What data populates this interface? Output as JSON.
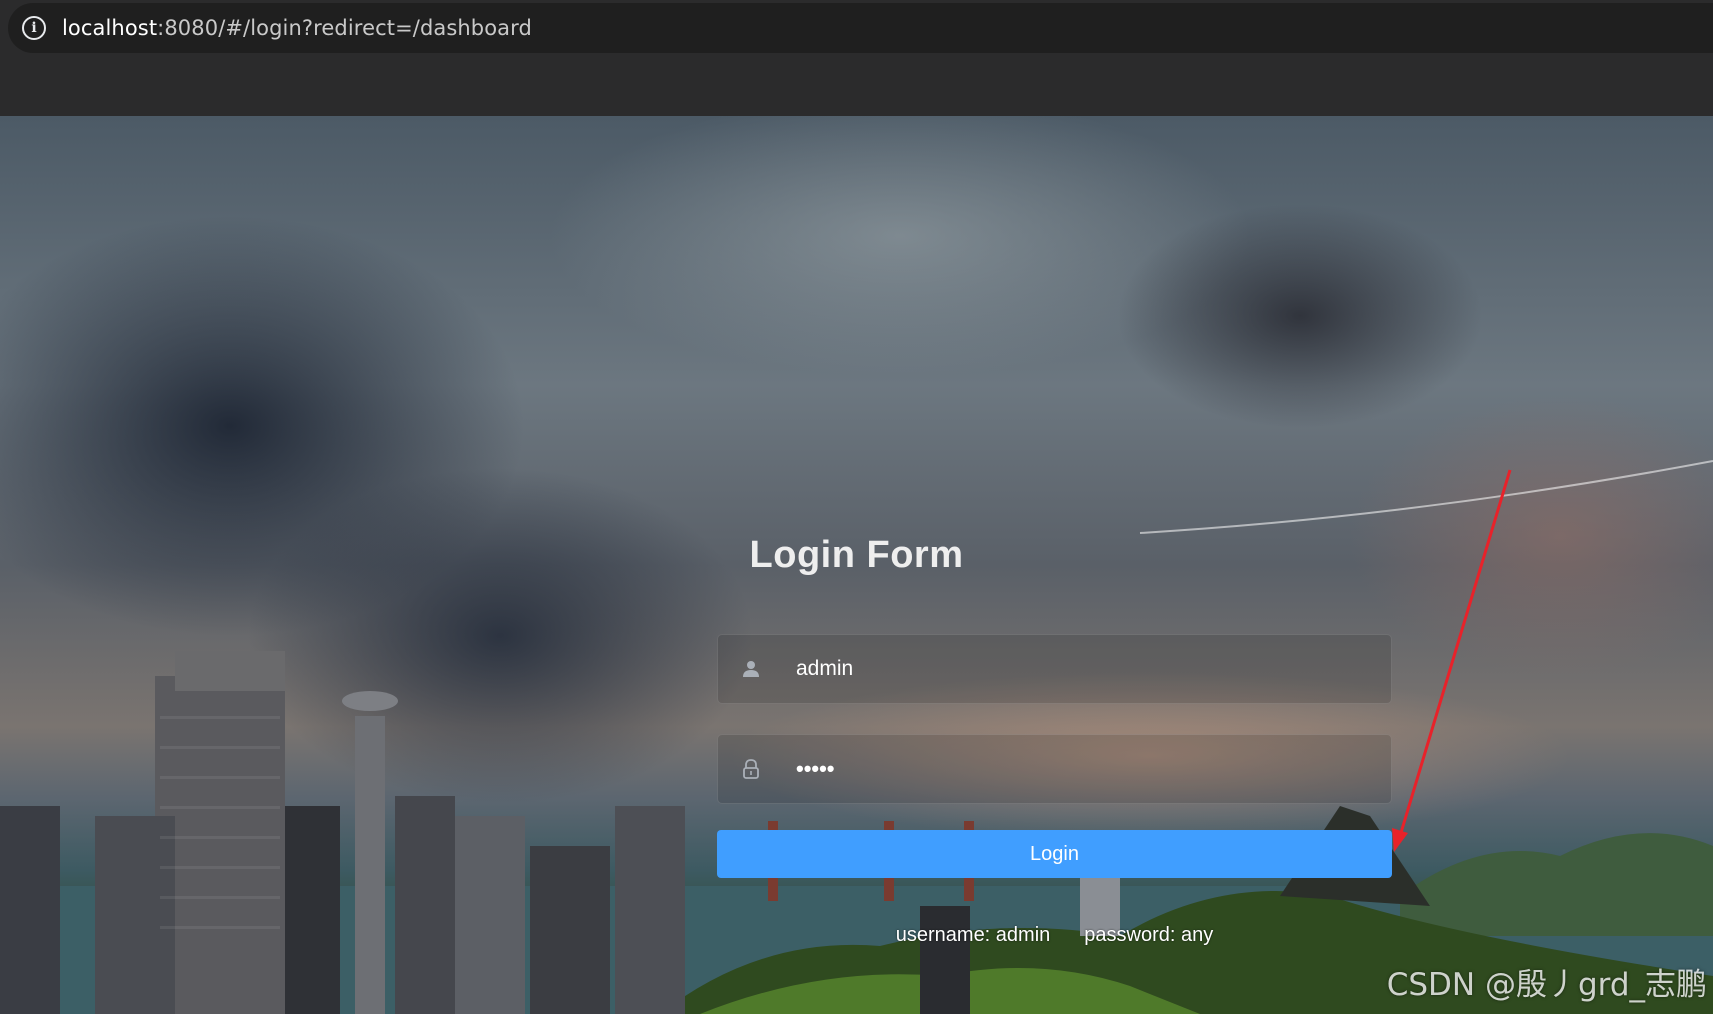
{
  "browser": {
    "url_host": "localhost",
    "url_rest": ":8080/#/login?redirect=/dashboard"
  },
  "login": {
    "title": "Login Form",
    "username_value": "admin",
    "password_mask": "•••••",
    "button_label": "Login",
    "tip_username": "username: admin",
    "tip_password": "password: any"
  },
  "watermark": "CSDN @殷丿grd_志鹏",
  "colors": {
    "button": "#409eff",
    "annotation_arrow": "#e8222a",
    "chrome": "#2b2b2c"
  },
  "icons": {
    "site_info": "info-icon",
    "username": "user-icon",
    "password": "lock-icon"
  }
}
